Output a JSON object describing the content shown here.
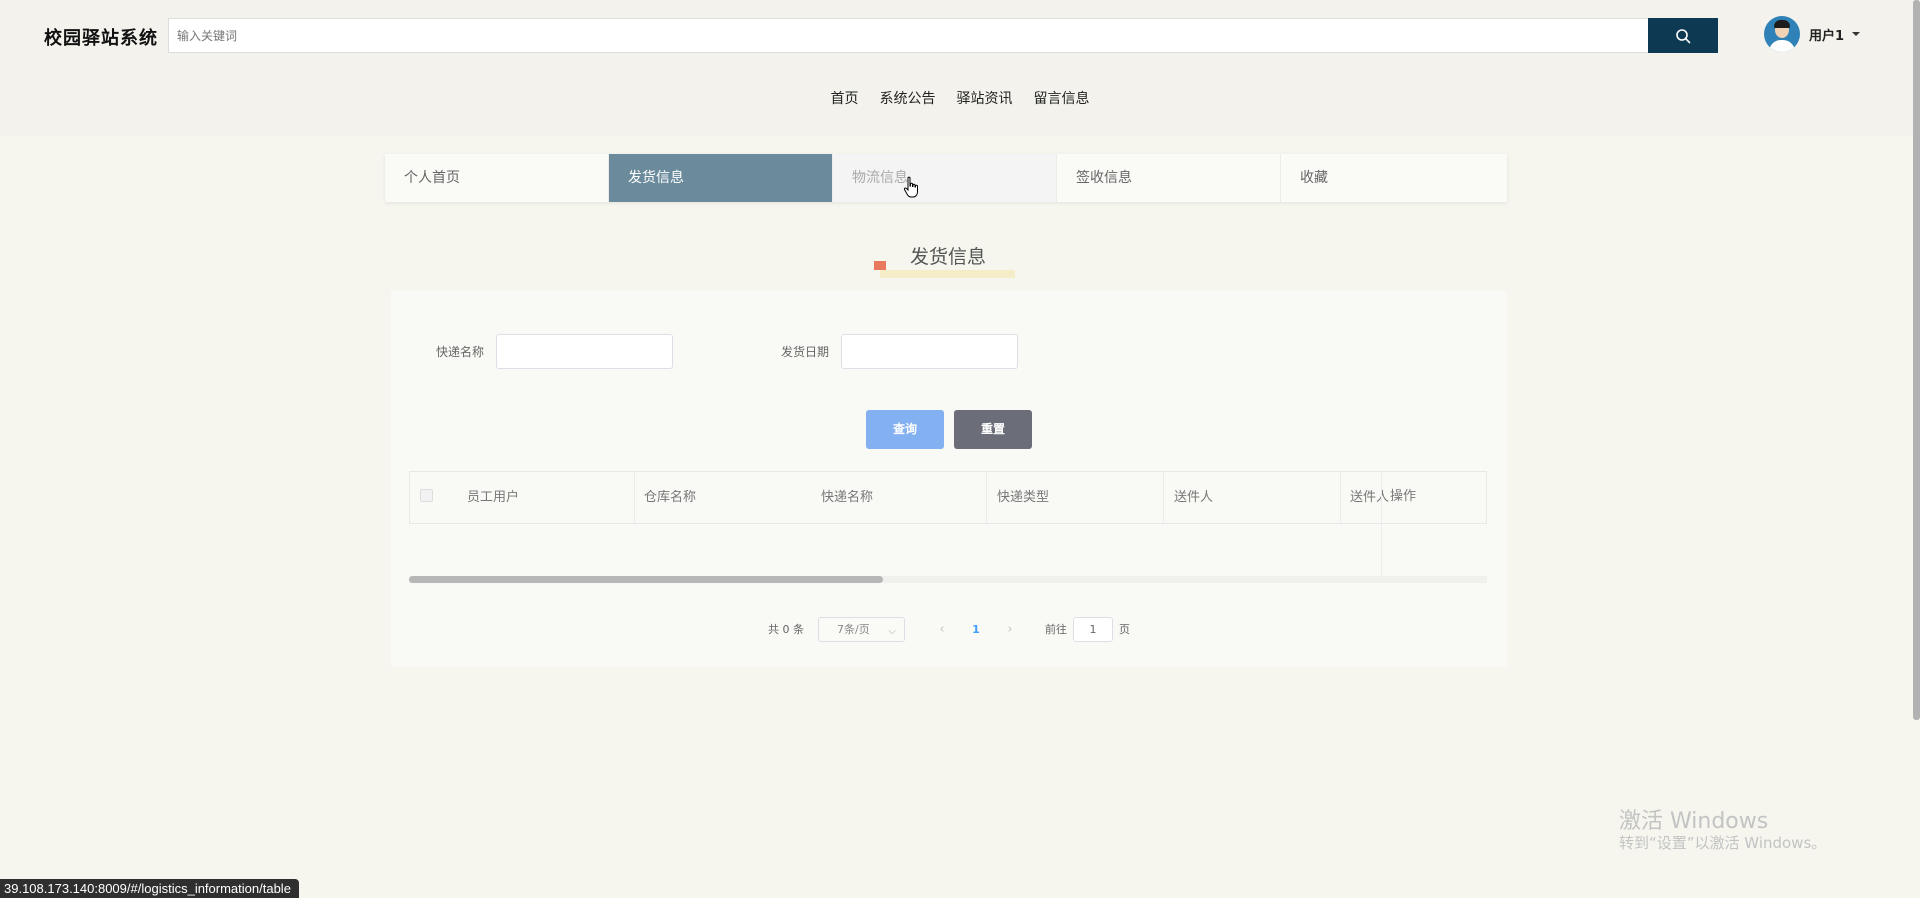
{
  "app": {
    "title": "校园驿站系统"
  },
  "search": {
    "placeholder": "输入关键词",
    "button_icon": "search-icon"
  },
  "user": {
    "name": "用户1",
    "avatar": "avatar-icon"
  },
  "nav": {
    "items": [
      "首页",
      "系统公告",
      "驿站资讯",
      "留言信息"
    ]
  },
  "tabs": [
    {
      "label": "个人首页",
      "state": "normal"
    },
    {
      "label": "发货信息",
      "state": "active"
    },
    {
      "label": "物流信息",
      "state": "hover"
    },
    {
      "label": "签收信息",
      "state": "normal"
    },
    {
      "label": "收藏",
      "state": "normal"
    }
  ],
  "page": {
    "title": "发货信息"
  },
  "filters": [
    {
      "label": "快递名称",
      "value": ""
    },
    {
      "label": "发货日期",
      "value": ""
    }
  ],
  "buttons": {
    "query": "查询",
    "reset": "重置"
  },
  "table": {
    "columns": [
      "员工用户",
      "仓库名称",
      "快递名称",
      "快递类型",
      "送件人",
      "送件人"
    ],
    "ops_header": "操作",
    "rows": []
  },
  "pagination": {
    "total_text": "共 0 条",
    "page_size": "7条/页",
    "current_page": "1",
    "goto_label": "前往",
    "goto_value": "1",
    "page_unit": "页"
  },
  "watermark": {
    "line1": "激活 Windows",
    "line2": "转到“设置”以激活 Windows。"
  },
  "status_bar": {
    "url": "39.108.173.140:8009/#/logistics_information/table"
  },
  "colors": {
    "search_button": "#0d3a52",
    "tab_active": "#6b8a9c",
    "query_button": "#82b0f0",
    "reset_button": "#6b6e78",
    "title_mark": "#e8785e",
    "page_link": "#409eff"
  }
}
